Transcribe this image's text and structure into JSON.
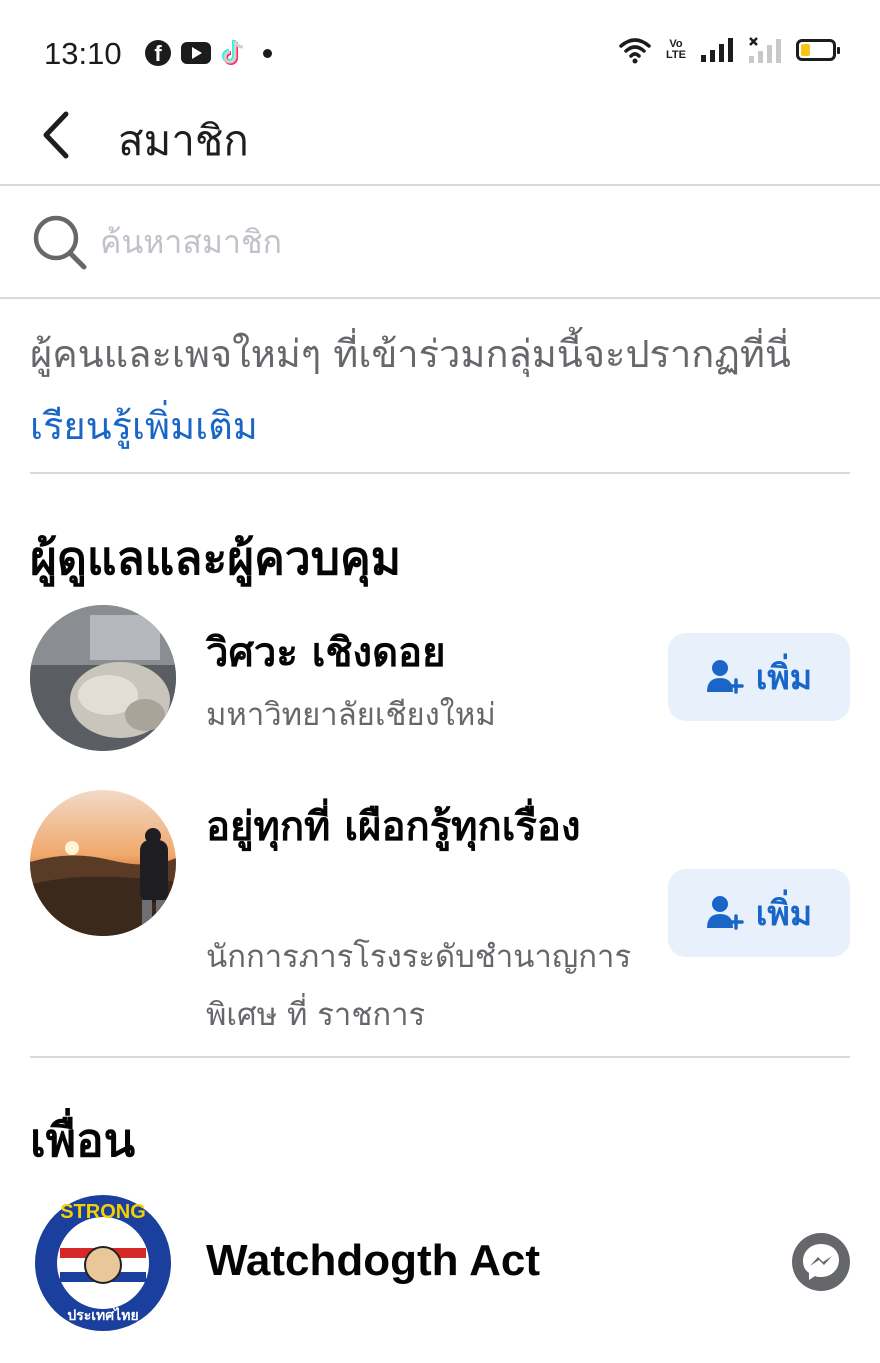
{
  "status_bar": {
    "time": "13:10",
    "volte_line1": "Vo",
    "volte_line2": "LTE",
    "icons": [
      "facebook-icon",
      "youtube-icon",
      "tiktok-icon",
      "notification-dot-icon",
      "wifi-icon",
      "volte-icon",
      "signal-icon",
      "signal-no-sim-icon",
      "battery-icon"
    ],
    "battery_color": "#f5c518"
  },
  "header": {
    "title": "สมาชิก"
  },
  "search": {
    "placeholder": "ค้นหาสมาชิก"
  },
  "info": {
    "text": "ผู้คนและเพจใหม่ๆ ที่เข้าร่วมกลุ่มนี้จะปรากฏที่นี่ ",
    "link": "เรียนรู้เพิ่มเติม"
  },
  "sections": {
    "admins_title": "ผู้ดูแลและผู้ควบคุม",
    "friends_title": "เพื่อน"
  },
  "admins": [
    {
      "name": "วิศวะ เชิงดอย",
      "subtitle": "มหาวิทยาลัยเชียงใหม่",
      "action_label": "เพิ่ม"
    },
    {
      "name": "อยู่ทุกที่ เผือกรู้ทุกเรื่อง",
      "subtitle": "นักการภารโรงระดับชำนาญการพิเศษ ที่ ราชการ",
      "action_label": "เพิ่ม"
    }
  ],
  "friends": [
    {
      "name": "Watchdogth Act",
      "avatar_text_top": "STRONG",
      "avatar_text_bottom": "ประเทศไทย"
    }
  ],
  "colors": {
    "accent": "#1a66c8",
    "button_bg": "#e7f0fb",
    "secondary_text": "#65676b",
    "divider": "#d8dadf"
  }
}
